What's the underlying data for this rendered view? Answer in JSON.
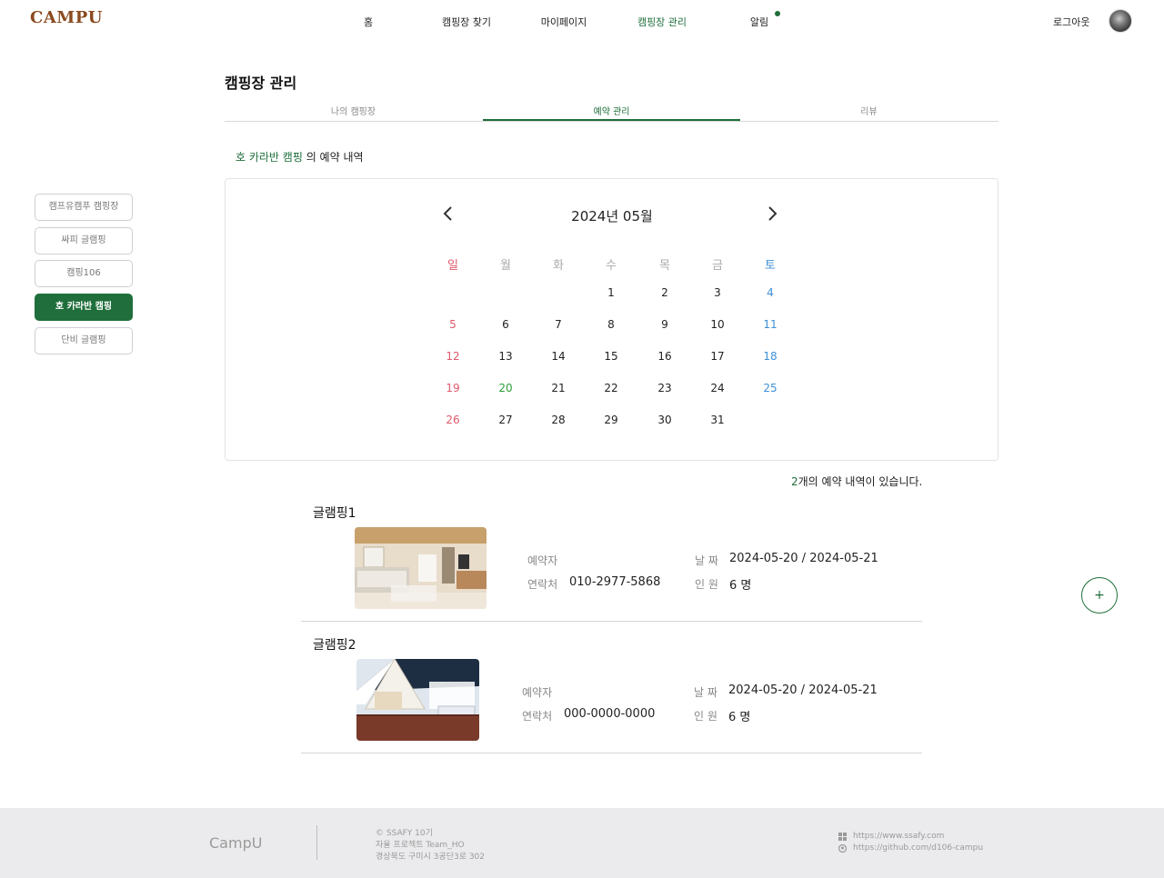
{
  "header": {
    "logo": "CAMPU",
    "nav": [
      {
        "label": "홈"
      },
      {
        "label": "캠핑장 찾기"
      },
      {
        "label": "마이페이지"
      },
      {
        "label": "캠핑장 관리"
      },
      {
        "label": "알림"
      }
    ],
    "active_nav": "캠핑장 관리",
    "logout_label": "로그아웃",
    "notification_dot": true
  },
  "page": {
    "title": "캠핑장 관리",
    "tabs": [
      {
        "label": "나의 캠핑장"
      },
      {
        "label": "예약 관리"
      },
      {
        "label": "리뷰"
      }
    ],
    "active_tab": "예약 관리"
  },
  "sidebar": {
    "items": [
      {
        "label": "캠프유캠푸 캠핑장"
      },
      {
        "label": "싸피 글램핑"
      },
      {
        "label": "캠핑106"
      },
      {
        "label": "호 카라반 캠핑"
      },
      {
        "label": "단비 글램핑"
      }
    ],
    "active_item": "호 카라반 캠핑"
  },
  "reservation_heading": {
    "camp_name": "호 카라반 캠핑",
    "suffix": "의 예약 내역"
  },
  "calendar": {
    "title": "2024년 05월",
    "prev_icon": "chevron-left-icon",
    "next_icon": "chevron-right-icon",
    "weekdays": [
      "일",
      "월",
      "화",
      "수",
      "목",
      "금",
      "토"
    ],
    "weeks": [
      [
        "",
        "",
        "",
        "1",
        "2",
        "3",
        "4"
      ],
      [
        "5",
        "6",
        "7",
        "8",
        "9",
        "10",
        "11"
      ],
      [
        "12",
        "13",
        "14",
        "15",
        "16",
        "17",
        "18"
      ],
      [
        "19",
        "20",
        "21",
        "22",
        "23",
        "24",
        "25"
      ],
      [
        "26",
        "27",
        "28",
        "29",
        "30",
        "31",
        ""
      ]
    ],
    "selected_day": "20"
  },
  "reservations_summary": {
    "count": "2",
    "text": "개의 예약 내역이 있습니다."
  },
  "reservations": [
    {
      "room": "글램핑1",
      "reserver_label": "예약자",
      "reserver_value": "",
      "contact_label": "연락처",
      "contact_value": "010-2977-5868",
      "date_label": "날 짜",
      "date_value": "2024-05-20 / 2024-05-21",
      "people_label": "인 원",
      "people_value": "6 명"
    },
    {
      "room": "글램핑2",
      "reserver_label": "예약자",
      "reserver_value": "",
      "contact_label": "연락처",
      "contact_value": "000-0000-0000",
      "date_label": "날 짜",
      "date_value": "2024-05-20 / 2024-05-21",
      "people_label": "인 원",
      "people_value": "6 명"
    }
  ],
  "fab": {
    "label": "+"
  },
  "footer": {
    "brand": "CampU",
    "lines": [
      "© SSAFY 10기",
      "자율 프로젝트 Team_HO",
      "경상북도 구미시 3공단3로 302"
    ],
    "links": [
      {
        "icon": "windows-icon",
        "text": "https://www.ssafy.com"
      },
      {
        "icon": "github-icon",
        "text": "https://github.com/d106-campu"
      }
    ]
  },
  "colors": {
    "accent": "#1f6e3b",
    "sunday": "#e05a6b",
    "saturday": "#3d8fd6",
    "today": "#2a9d3a",
    "footer_bg": "#ebebed"
  }
}
